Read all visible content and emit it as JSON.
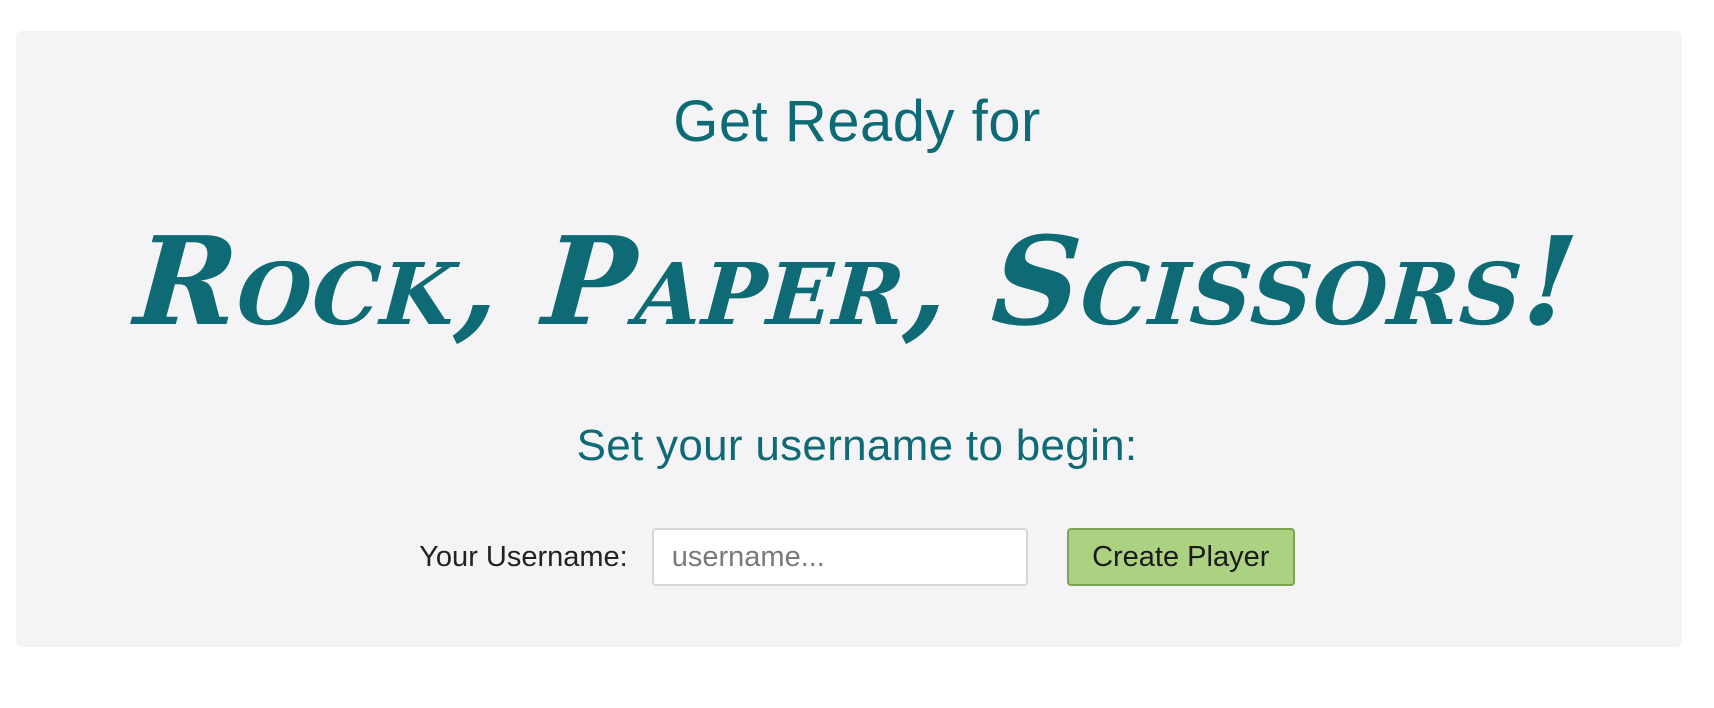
{
  "header": {
    "pre_title": "Get Ready for",
    "title": "Rock, Paper, Scissors!",
    "subtitle": "Set your username to begin:"
  },
  "form": {
    "username_label": "Your Username:",
    "username_placeholder": "username...",
    "username_value": "",
    "create_button_label": "Create Player"
  },
  "colors": {
    "accent": "#0e6a74",
    "panel_background": "#f4f4f6",
    "button_background": "#acd180",
    "button_border": "#7aa653"
  }
}
